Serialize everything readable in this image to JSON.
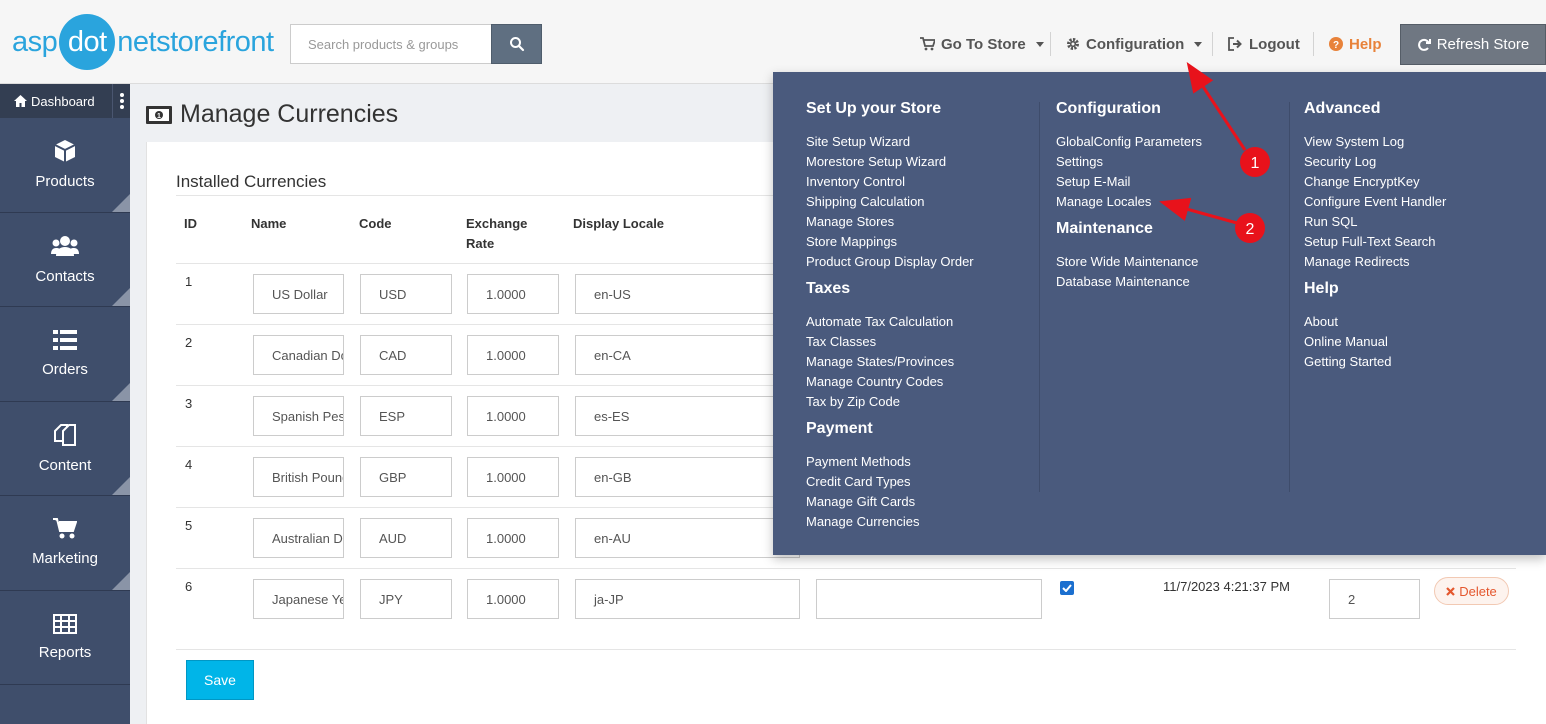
{
  "logo": {
    "part1": "asp",
    "part2": "dot",
    "part3": "net",
    "part4": "storefront"
  },
  "search": {
    "placeholder": "Search products & groups",
    "icon": "search-icon"
  },
  "topnav": {
    "go_to_store": "Go To Store",
    "configuration": "Configuration",
    "logout": "Logout",
    "help": "Help",
    "refresh": "Refresh Store"
  },
  "sidebar": {
    "dashboard": "Dashboard",
    "items": [
      {
        "label": "Products",
        "icon": "cube-icon"
      },
      {
        "label": "Contacts",
        "icon": "users-icon"
      },
      {
        "label": "Orders",
        "icon": "list-icon"
      },
      {
        "label": "Content",
        "icon": "copy-icon"
      },
      {
        "label": "Marketing",
        "icon": "cart-icon"
      },
      {
        "label": "Reports",
        "icon": "table-icon"
      }
    ]
  },
  "page": {
    "title": "Manage Currencies",
    "subtitle": "Installed Currencies"
  },
  "table": {
    "headers": {
      "id": "ID",
      "name": "Name",
      "code": "Code",
      "rate_line1": "Exchange",
      "rate_line2": "Rate",
      "locale": "Display Locale"
    },
    "rows": [
      {
        "id": "1",
        "name": "US Dollar",
        "code": "USD",
        "rate": "1.0000",
        "locale": "en-US"
      },
      {
        "id": "2",
        "name": "Canadian Dollar",
        "code": "CAD",
        "rate": "1.0000",
        "locale": "en-CA"
      },
      {
        "id": "3",
        "name": "Spanish Peseta",
        "code": "ESP",
        "rate": "1.0000",
        "locale": "es-ES"
      },
      {
        "id": "4",
        "name": "British Pound",
        "code": "GBP",
        "rate": "1.0000",
        "locale": "en-GB"
      },
      {
        "id": "5",
        "name": "Australian Dollar",
        "code": "AUD",
        "rate": "1.0000",
        "locale": "en-AU"
      },
      {
        "id": "6",
        "name": "Japanese Yen",
        "code": "JPY",
        "rate": "1.0000",
        "locale": "ja-JP",
        "updated": "11/7/2023 4:21:37 PM",
        "display_order": "2"
      }
    ],
    "delete_label": "Delete"
  },
  "save_label": "Save",
  "mega_menu": {
    "setup": {
      "heading": "Set Up your Store",
      "items": [
        "Site Setup Wizard",
        "Morestore Setup Wizard",
        "Inventory Control",
        "Shipping Calculation",
        "Manage Stores",
        "Store Mappings",
        "Product Group Display Order"
      ]
    },
    "taxes": {
      "heading": "Taxes",
      "items": [
        "Automate Tax Calculation",
        "Tax Classes",
        "Manage States/Provinces",
        "Manage Country Codes",
        "Tax by Zip Code"
      ]
    },
    "payment": {
      "heading": "Payment",
      "items": [
        "Payment Methods",
        "Credit Card Types",
        "Manage Gift Cards",
        "Manage Currencies"
      ]
    },
    "configuration": {
      "heading": "Configuration",
      "items": [
        "GlobalConfig Parameters",
        "Settings",
        "Setup E-Mail",
        "Manage Locales"
      ]
    },
    "maintenance": {
      "heading": "Maintenance",
      "items": [
        "Store Wide Maintenance",
        "Database Maintenance"
      ]
    },
    "advanced": {
      "heading": "Advanced",
      "items": [
        "View System Log",
        "Security Log",
        "Change EncryptKey",
        "Configure Event Handler",
        "Run SQL",
        "Setup Full-Text Search",
        "Manage Redirects"
      ]
    },
    "help": {
      "heading": "Help",
      "items": [
        "About",
        "Online Manual",
        "Getting Started"
      ]
    }
  },
  "annotations": {
    "marker1": "1",
    "marker2": "2",
    "color": "#e8121b"
  }
}
